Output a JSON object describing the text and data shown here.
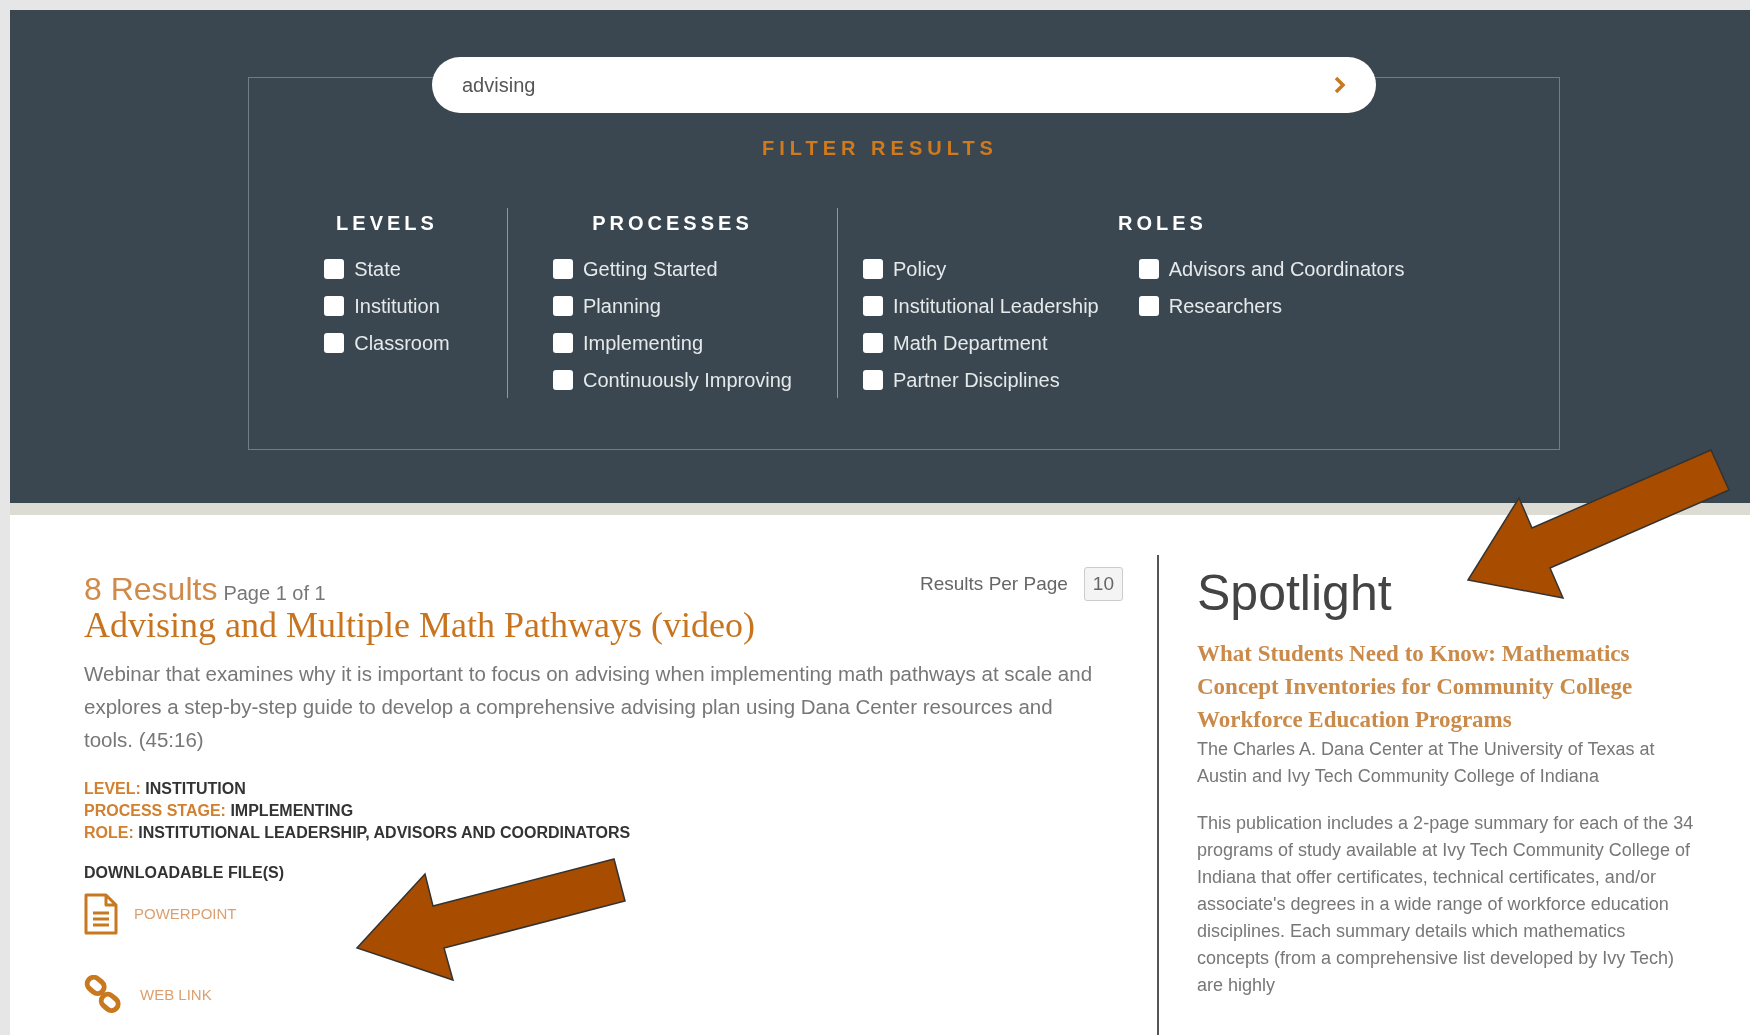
{
  "search": {
    "value": "advising"
  },
  "filter": {
    "title": "FILTER RESULTS",
    "groups": [
      {
        "heading": "LEVELS",
        "columns": [
          [
            {
              "label": "State",
              "checked": false
            },
            {
              "label": "Institution",
              "checked": false
            },
            {
              "label": "Classroom",
              "checked": false
            }
          ]
        ]
      },
      {
        "heading": "PROCESSES",
        "columns": [
          [
            {
              "label": "Getting Started",
              "checked": false
            },
            {
              "label": "Planning",
              "checked": false
            },
            {
              "label": "Implementing",
              "checked": false
            },
            {
              "label": "Continuously Improving",
              "checked": false
            }
          ]
        ]
      },
      {
        "heading": "ROLES",
        "columns": [
          [
            {
              "label": "Policy",
              "checked": false
            },
            {
              "label": "Institutional Leadership",
              "checked": false
            },
            {
              "label": "Math Department",
              "checked": false
            },
            {
              "label": "Partner Disciplines",
              "checked": false
            }
          ],
          [
            {
              "label": "Advisors and Coordinators",
              "checked": false
            },
            {
              "label": "Researchers",
              "checked": false
            }
          ]
        ]
      }
    ]
  },
  "results": {
    "count": "8 Results",
    "page": "Page 1 of 1",
    "per_page_label": "Results Per Page",
    "per_page": "10",
    "item": {
      "title": "Advising and Multiple Math Pathways (video)",
      "description": "Webinar that examines why it is important to focus on advising when implementing math pathways at scale and explores a step-by-step guide to develop a comprehensive advising plan using Dana Center resources and tools. (45:16)",
      "meta": [
        {
          "label": "LEVEL:",
          "value": "INSTITUTION"
        },
        {
          "label": "PROCESS STAGE:",
          "value": "IMPLEMENTING"
        },
        {
          "label": "ROLE:",
          "value": "INSTITUTIONAL LEADERSHIP, ADVISORS AND COORDINATORS"
        }
      ],
      "downloads_heading": "DOWNLOADABLE FILE(S)",
      "links": [
        {
          "kind": "file",
          "label": "POWERPOINT"
        },
        {
          "kind": "link",
          "label": "WEB LINK"
        }
      ]
    }
  },
  "spotlight": {
    "heading": "Spotlight",
    "title": "What Students Need to Know: Mathematics Concept Inventories for Community College Workforce Education Programs",
    "author": "The Charles A. Dana Center at The University of Texas at Austin and Ivy Tech Community College of Indiana",
    "description": "This publication includes a 2-page summary for each of the 34 programs of study available at Ivy Tech Community College of Indiana that offer certificates, technical certificates, and/or associate's degrees in a wide range of workforce education disciplines. Each summary details which mathematics concepts (from a comprehensive list developed by Ivy Tech) are highly"
  }
}
